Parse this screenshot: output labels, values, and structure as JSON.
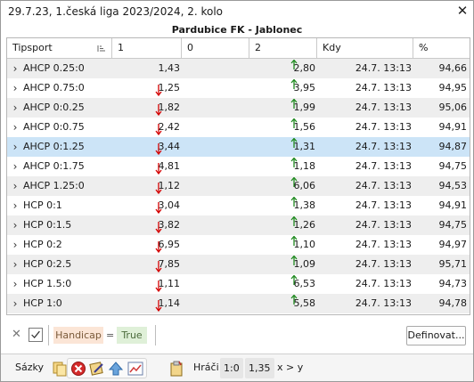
{
  "window": {
    "title": "29.7.23, 1.česká liga 2023/2024, 2. kolo",
    "close_label": "✕"
  },
  "match_title": "Pardubice FK - Jablonec",
  "columns": {
    "tipsport": "Tipsport",
    "one": "1",
    "zero": "0",
    "two": "2",
    "kdy": "Kdy",
    "pct": "%"
  },
  "rows": [
    {
      "name": "AHCP 0.25:0",
      "v1": "1,43",
      "v2": "2,80",
      "when": "24.7. 13:13",
      "pct": "94,66",
      "arrow1": "none",
      "arrow2": "up"
    },
    {
      "name": "AHCP 0.75:0",
      "v1": "1,25",
      "v2": "3,95",
      "when": "24.7. 13:13",
      "pct": "94,95",
      "arrow1": "down",
      "arrow2": "up"
    },
    {
      "name": "AHCP 0:0.25",
      "v1": "1,82",
      "v2": "1,99",
      "when": "24.7. 13:13",
      "pct": "95,06",
      "arrow1": "down",
      "arrow2": "up"
    },
    {
      "name": "AHCP 0:0.75",
      "v1": "2,42",
      "v2": "1,56",
      "when": "24.7. 13:13",
      "pct": "94,91",
      "arrow1": "down",
      "arrow2": "up"
    },
    {
      "name": "AHCP 0:1.25",
      "v1": "3,44",
      "v2": "1,31",
      "when": "24.7. 13:13",
      "pct": "94,87",
      "arrow1": "down",
      "arrow2": "up",
      "selected": true
    },
    {
      "name": "AHCP 0:1.75",
      "v1": "4,81",
      "v2": "1,18",
      "when": "24.7. 13:13",
      "pct": "94,75",
      "arrow1": "down",
      "arrow2": "up"
    },
    {
      "name": "AHCP 1.25:0",
      "v1": "1,12",
      "v2": "6,06",
      "when": "24.7. 13:13",
      "pct": "94,53",
      "arrow1": "down",
      "arrow2": "up"
    },
    {
      "name": "HCP 0:1",
      "v1": "3,04",
      "v2": "1,38",
      "when": "24.7. 13:13",
      "pct": "94,91",
      "arrow1": "down",
      "arrow2": "up"
    },
    {
      "name": "HCP 0:1.5",
      "v1": "3,82",
      "v2": "1,26",
      "when": "24.7. 13:13",
      "pct": "94,75",
      "arrow1": "down",
      "arrow2": "up"
    },
    {
      "name": "HCP 0:2",
      "v1": "6,95",
      "v2": "1,10",
      "when": "24.7. 13:13",
      "pct": "94,97",
      "arrow1": "down",
      "arrow2": "up"
    },
    {
      "name": "HCP 0:2.5",
      "v1": "7,85",
      "v2": "1,09",
      "when": "24.7. 13:13",
      "pct": "95,71",
      "arrow1": "down",
      "arrow2": "up"
    },
    {
      "name": "HCP 1.5:0",
      "v1": "1,11",
      "v2": "6,53",
      "when": "24.7. 13:13",
      "pct": "94,73",
      "arrow1": "down",
      "arrow2": "up"
    },
    {
      "name": "HCP 1:0",
      "v1": "1,14",
      "v2": "5,58",
      "when": "24.7. 13:13",
      "pct": "94,78",
      "arrow1": "down",
      "arrow2": "up"
    }
  ],
  "filter": {
    "clear_label": "✕",
    "field": "Handicap",
    "operator": "=",
    "value": "True",
    "define_label": "Definovat..."
  },
  "bottom": {
    "sazky_label": "Sázky",
    "hraci_label": "Hráči",
    "ratio_label": "1:0",
    "odds_label": "1,35",
    "xy_label": "x > y"
  },
  "colors": {
    "selected_row": "#cce4f7",
    "alt_row": "#eeeeee",
    "arrow_down": "#d40000",
    "arrow_up": "#1f8a1f",
    "filter_field_bg": "#fbe5d6",
    "filter_value_bg": "#dff0d8"
  }
}
